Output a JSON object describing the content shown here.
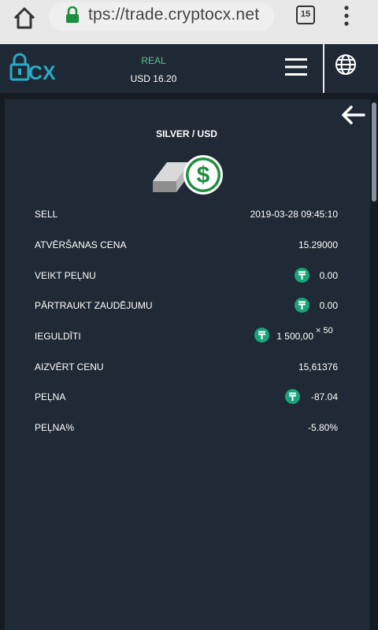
{
  "browser": {
    "url": "tps://trade.cryptocx.net",
    "tab_count": "15"
  },
  "header": {
    "logo_text": "CX",
    "account_type": "REAL",
    "balance": "USD 16.20"
  },
  "trade": {
    "title": "SILVER / USD",
    "rows": [
      {
        "label": "SELL",
        "value": "2019-03-28 09:45:10"
      },
      {
        "label": "ATVĒRŠANAS CENA",
        "value": "15.29000"
      },
      {
        "label": "VEIKT PEĻNU",
        "value": "0.00"
      },
      {
        "label": "PĀRTRAUKT ZAUDĒJUMU",
        "value": "0.00"
      },
      {
        "label": "IEGULDĪTI",
        "value": "1 500,00",
        "multiplier": "× 50"
      },
      {
        "label": "AIZVĒRT CENU",
        "value": "15,61376"
      },
      {
        "label": "PEĻNA",
        "value": "-87.04"
      },
      {
        "label": "PEĻNA%",
        "value": "-5.80%"
      }
    ]
  },
  "colors": {
    "accent_green": "#1aa37a",
    "header_bg": "#1f2935",
    "panel_bg": "#1f2a36"
  }
}
